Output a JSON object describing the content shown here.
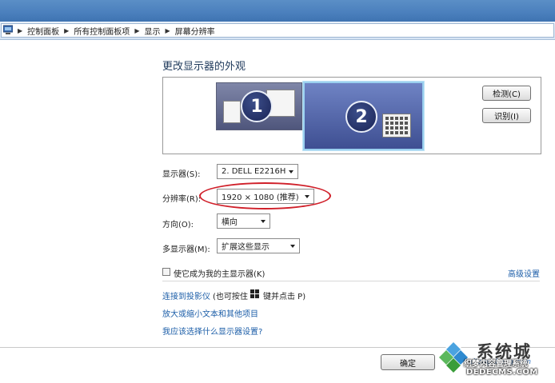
{
  "breadcrumb": [
    "控制面板",
    "所有控制面板项",
    "显示",
    "屏幕分辨率"
  ],
  "heading": "更改显示器的外观",
  "monitors": [
    {
      "number": "1"
    },
    {
      "number": "2"
    }
  ],
  "buttons": {
    "detect": "检测(C)",
    "identify": "识别(I)",
    "ok": "确定"
  },
  "settings": {
    "display_label": "显示器(S):",
    "display_value": "2. DELL E2216H",
    "resolution_label": "分辨率(R):",
    "resolution_value": "1920 × 1080 (推荐)",
    "orientation_label": "方向(O):",
    "orientation_value": "横向",
    "multi_label": "多显示器(M):",
    "multi_value": "扩展这些显示"
  },
  "checkbox_label": "使它成为我的主显示器(K)",
  "advanced_link": "高级设置",
  "links": {
    "projector": "连接到投影仪",
    "projector_hint": "(也可按住",
    "projector_hint2": "键并点击 P)",
    "text_size": "放大或缩小文本和其他项目",
    "which_settings": "我应该选择什么显示器设置?"
  },
  "watermark": {
    "brand": "系统城",
    "url": "xitongcheng.com",
    "cn_text": "织梦内容管理系统",
    "site": "DEDECMS.COM"
  },
  "colors": {
    "highlight_ellipse": "#d0202a",
    "link": "#1c5ea8",
    "heading": "#1e395b"
  }
}
